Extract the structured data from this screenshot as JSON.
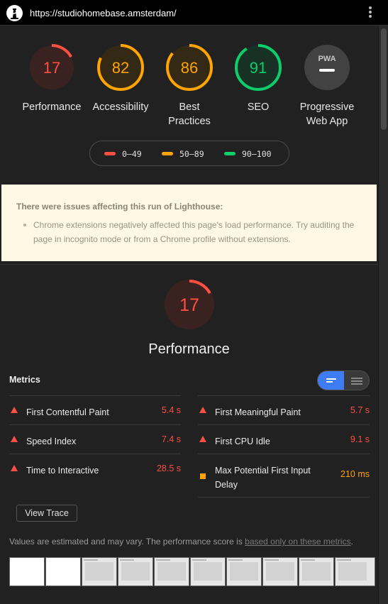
{
  "browser": {
    "url": "https://studiohomebase.amsterdam/",
    "logo_icon": "lighthouse-icon",
    "menu_icon": "kebab-menu-icon"
  },
  "gauges": [
    {
      "label": "Performance",
      "score": "17",
      "level": "fail"
    },
    {
      "label": "Accessibility",
      "score": "82",
      "level": "average"
    },
    {
      "label": "Best Practices",
      "score": "86",
      "level": "average"
    },
    {
      "label": "SEO",
      "score": "91",
      "level": "pass"
    },
    {
      "label": "Progressive Web App",
      "score": "",
      "badge": "PWA",
      "level": "na"
    }
  ],
  "legend": [
    {
      "range": "0–49",
      "color": "#ff4e42"
    },
    {
      "range": "50–89",
      "color": "#ffa400"
    },
    {
      "range": "90–100",
      "color": "#0cce6b"
    }
  ],
  "warning": {
    "title": "There were issues affecting this run of Lighthouse:",
    "items": [
      "Chrome extensions negatively affected this page's load performance. Try auditing the page in incognito mode or from a Chrome profile without extensions."
    ]
  },
  "performance": {
    "score": "17",
    "title": "Performance"
  },
  "metrics": {
    "title": "Metrics",
    "items": [
      {
        "name": "First Contentful Paint",
        "value": "5.4 s",
        "status": "fail"
      },
      {
        "name": "First Meaningful Paint",
        "value": "5.7 s",
        "status": "fail"
      },
      {
        "name": "Speed Index",
        "value": "7.4 s",
        "status": "fail"
      },
      {
        "name": "First CPU Idle",
        "value": "9.1 s",
        "status": "fail"
      },
      {
        "name": "Time to Interactive",
        "value": "28.5 s",
        "status": "fail"
      },
      {
        "name": "Max Potential First Input Delay",
        "value": "210 ms",
        "status": "average"
      }
    ]
  },
  "view_trace_label": "View Trace",
  "disclaimer": {
    "text": "Values are estimated and may vary. The performance score is ",
    "link": "based only on these metrics",
    "end": "."
  },
  "colors": {
    "fail": "#ff4e42",
    "average": "#ffa400",
    "pass": "#0cce6b"
  }
}
